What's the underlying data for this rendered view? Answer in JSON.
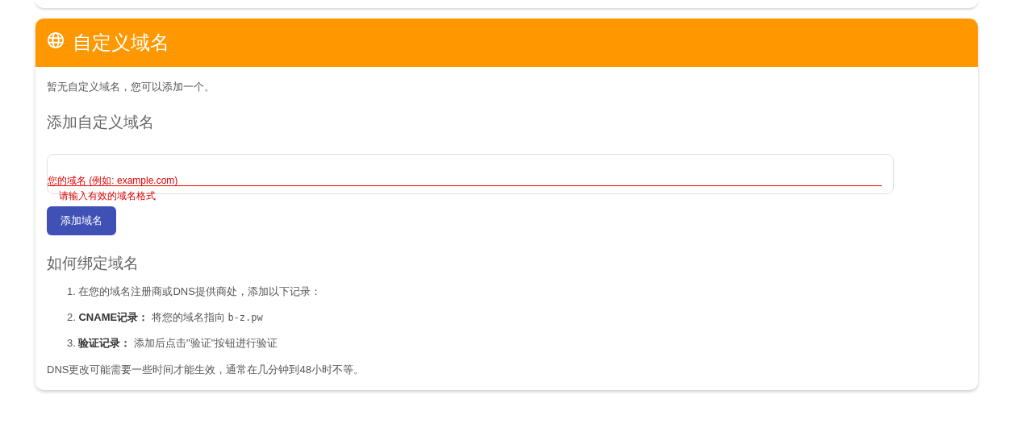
{
  "card": {
    "title": "自定义域名",
    "empty_message": "暂无自定义域名，您可以添加一个。",
    "add_section": {
      "heading": "添加自定义域名",
      "field": {
        "label": "您的域名 (例如: example.com)",
        "invalid": true,
        "error": "请输入有效的域名格式"
      },
      "button": "添加域名"
    },
    "howto": {
      "heading": "如何绑定域名",
      "steps": [
        {
          "number": "1.",
          "text": "在您的域名注册商或DNS提供商处，添加以下记录："
        },
        {
          "number": "2.",
          "label": "CNAME记录：",
          "text": "将您的域名指向",
          "code": "b-z.pw"
        },
        {
          "number": "3.",
          "label": "验证记录：",
          "text": "添加后点击\"验证\"按钮进行验证"
        }
      ],
      "note": "DNS更改可能需要一些时间才能生效，通常在几分钟到48小时不等。"
    }
  }
}
